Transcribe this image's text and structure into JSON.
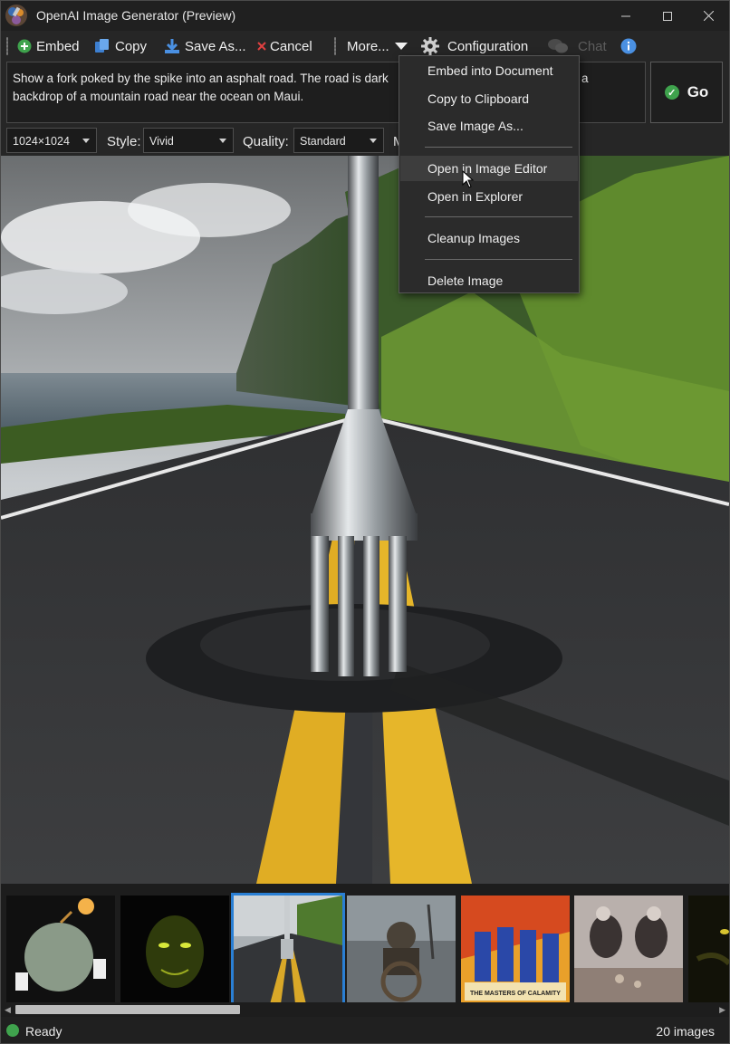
{
  "window": {
    "title": "OpenAI Image Generator (Preview)"
  },
  "toolbar": {
    "embed": "Embed",
    "copy": "Copy",
    "save_as": "Save As...",
    "cancel": "Cancel",
    "more": "More...",
    "configuration": "Configuration",
    "chat": "Chat"
  },
  "prompt": {
    "text_line1": "Show a fork poked by the spike into an asphalt road. The road is dark",
    "text_line1_tail": "a",
    "text_line2": "backdrop of a mountain road near the ocean on Maui."
  },
  "go_button": {
    "label": "Go"
  },
  "options": {
    "size_value": "1024×1024",
    "style_label": "Style:",
    "style_value": "Vivid",
    "quality_label": "Quality:",
    "quality_value": "Standard",
    "model_label_partial": "M"
  },
  "context_menu": {
    "items": [
      "Embed into Document",
      "Copy to Clipboard",
      "Save Image As...",
      "Open in Image Editor",
      "Open in Explorer",
      "Cleanup Images",
      "Delete Image"
    ]
  },
  "thumbnails": {
    "selected_index": 2,
    "poster_caption": "THE MASTERS OF CALAMITY"
  },
  "status": {
    "text": "Ready",
    "count": "20 images"
  },
  "colors": {
    "accent": "#2a7fd4",
    "ok_green": "#3fa34d",
    "cancel_red": "#e04040",
    "icon_blue": "#4a90e2"
  },
  "icons": [
    "app-icon",
    "minimize-icon",
    "maximize-icon",
    "close-icon",
    "plus-circle-icon",
    "copy-icon",
    "download-icon",
    "x-icon",
    "chevron-down-icon",
    "gear-icon",
    "chat-bubbles-icon",
    "info-icon",
    "check-circle-icon",
    "cursor-icon"
  ]
}
